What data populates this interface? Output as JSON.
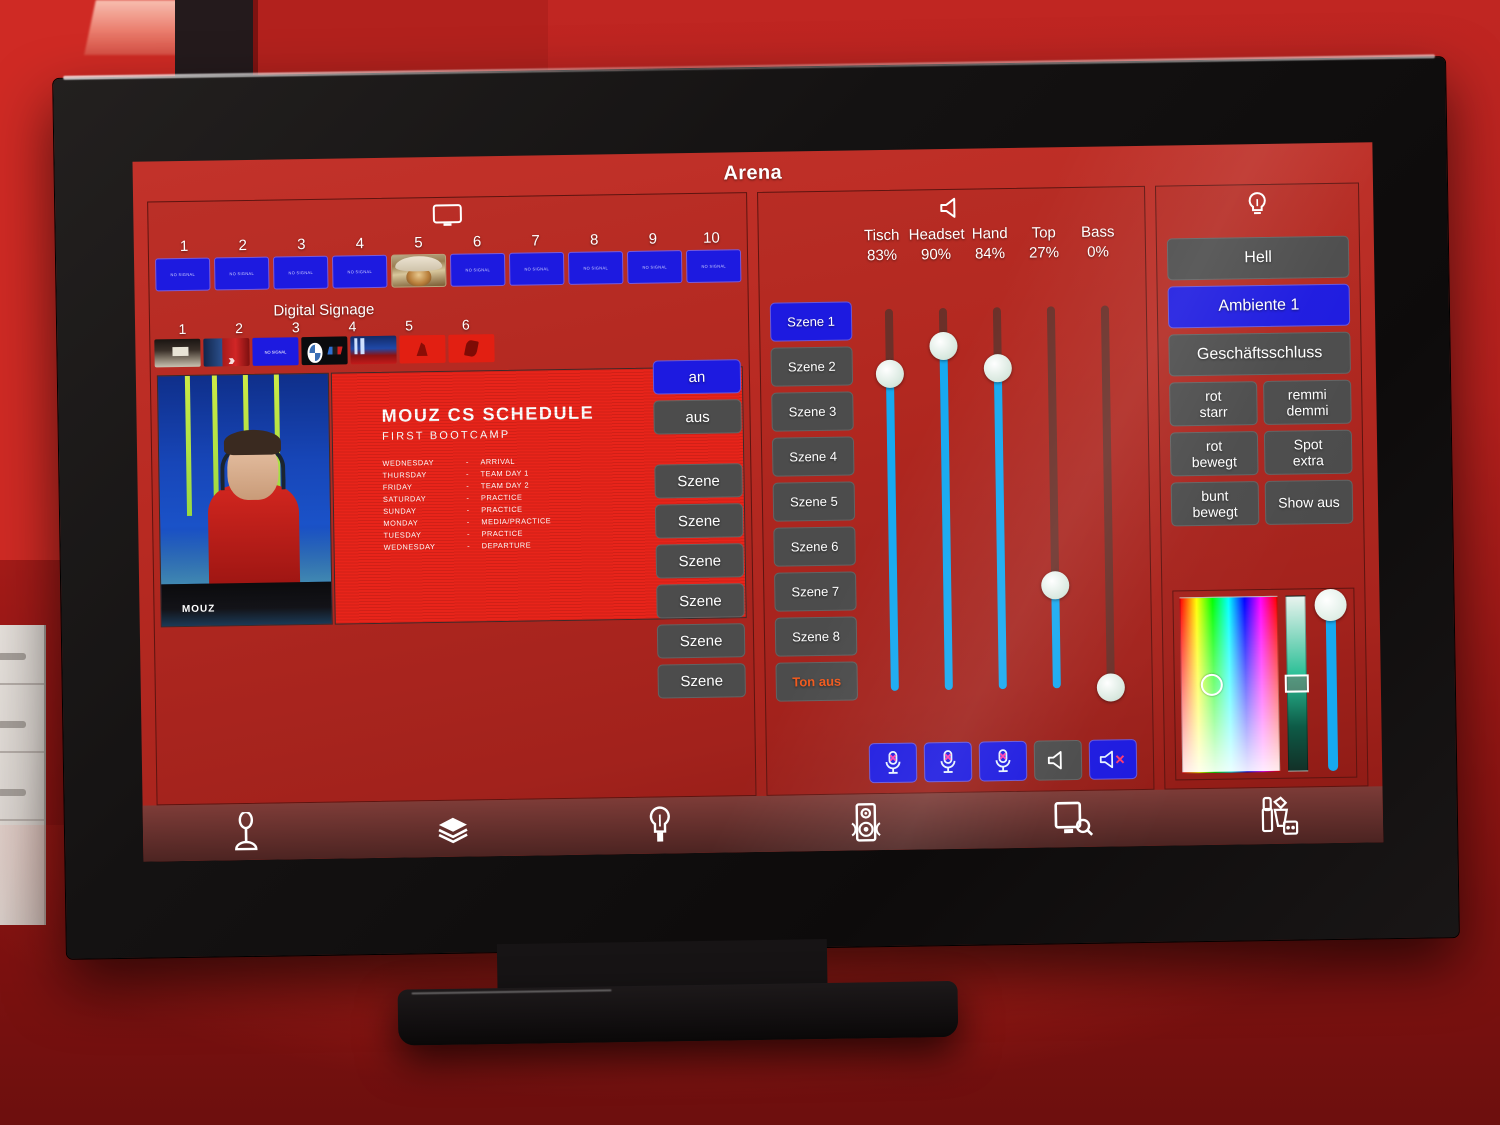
{
  "app": {
    "title": "Arena"
  },
  "panel_displays": {
    "icon": "monitor-icon",
    "numbers": [
      "1",
      "2",
      "3",
      "4",
      "5",
      "6",
      "7",
      "8",
      "9",
      "10"
    ],
    "tile_placeholder": "NO SIGNAL",
    "active_image_slot": 5,
    "digital_signage": {
      "label": "Digital Signage",
      "numbers": [
        "1",
        "2",
        "3",
        "4",
        "5",
        "6"
      ],
      "thumbnails": [
        "road-scene",
        "problems-poster",
        "no-signal-blue",
        "bmw-m-logo",
        "event-poster",
        "mouz-red-logo",
        "mouz-red-logo-2"
      ]
    },
    "on_label": "an",
    "off_label": "aus",
    "scene_buttons": [
      "Szene",
      "Szene",
      "Szene",
      "Szene",
      "Szene",
      "Szene"
    ],
    "preview": {
      "player_logo": "MOUZ",
      "schedule": {
        "title": "MOUZ CS SCHEDULE",
        "subtitle": "FIRST BOOTCAMP",
        "separator": "-",
        "rows": [
          {
            "day": "WEDNESDAY",
            "activity": "ARRIVAL"
          },
          {
            "day": "THURSDAY",
            "activity": "TEAM DAY 1"
          },
          {
            "day": "FRIDAY",
            "activity": "TEAM DAY 2"
          },
          {
            "day": "SATURDAY",
            "activity": "PRACTICE"
          },
          {
            "day": "SUNDAY",
            "activity": "PRACTICE"
          },
          {
            "day": "MONDAY",
            "activity": "MEDIA/PRACTICE"
          },
          {
            "day": "TUESDAY",
            "activity": "PRACTICE"
          },
          {
            "day": "WEDNESDAY",
            "activity": "DEPARTURE"
          }
        ]
      }
    }
  },
  "panel_audio": {
    "icon": "speaker-icon",
    "faders": [
      {
        "name": "Tisch",
        "value": "83%",
        "percent": 83
      },
      {
        "name": "Headset",
        "value": "90%",
        "percent": 90
      },
      {
        "name": "Hand",
        "value": "84%",
        "percent": 84
      },
      {
        "name": "Top",
        "value": "27%",
        "percent": 27
      },
      {
        "name": "Bass",
        "value": "0%",
        "percent": 0
      }
    ],
    "scenes": [
      "Szene 1",
      "Szene 2",
      "Szene 3",
      "Szene 4",
      "Szene 5",
      "Szene 6",
      "Szene 7",
      "Szene 8"
    ],
    "selected_scene": "Szene 1",
    "mute_all_label": "Ton aus",
    "buttons": [
      {
        "icon": "mic-muted-icon",
        "state": "active"
      },
      {
        "icon": "mic-muted-icon",
        "state": "active"
      },
      {
        "icon": "mic-muted-icon",
        "state": "active"
      },
      {
        "icon": "speaker-icon",
        "state": "inactive"
      },
      {
        "icon": "speaker-muted-icon",
        "state": "active"
      }
    ]
  },
  "panel_light": {
    "icon": "lightbulb-icon",
    "presets": [
      {
        "label": "Hell",
        "selected": false
      },
      {
        "label": "Ambiente 1",
        "selected": true
      },
      {
        "label": "Geschäftsschluss",
        "selected": false
      }
    ],
    "effects": [
      {
        "line1": "rot",
        "line2": "starr"
      },
      {
        "line1": "remmi",
        "line2": "demmi"
      },
      {
        "line1": "rot",
        "line2": "bewegt"
      },
      {
        "line1": "Spot",
        "line2": "extra"
      },
      {
        "line1": "bunt",
        "line2": "bewegt"
      },
      {
        "line1": "Show aus",
        "line2": ""
      }
    ],
    "color_picker": {
      "hue_x_percent": 31,
      "sat_y_percent": 50,
      "value_percent": 50,
      "brightness_percent": 96
    }
  },
  "nav": {
    "items": [
      {
        "icon": "joystick-icon",
        "name": "nav-joystick"
      },
      {
        "icon": "layers-icon",
        "name": "nav-layers"
      },
      {
        "icon": "lightbulb-icon",
        "name": "nav-light"
      },
      {
        "icon": "speaker-icon",
        "name": "nav-audio"
      },
      {
        "icon": "display-icon",
        "name": "nav-display"
      },
      {
        "icon": "drinks-icon",
        "name": "nav-catering"
      }
    ]
  },
  "colors": {
    "accent_blue": "#1d1ae0",
    "slider_blue": "#17a9f0",
    "button_grey": "#4c4c4c",
    "screen_red": "#b82a22",
    "mute_orange": "#f05a1e"
  }
}
